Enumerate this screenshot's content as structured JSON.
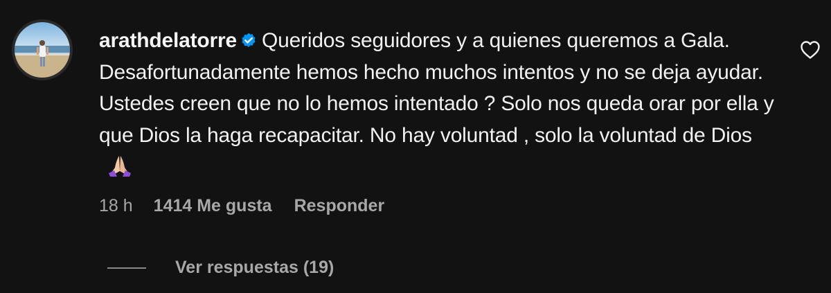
{
  "comment": {
    "username": "arathdelatorre",
    "verified": true,
    "text": "Queridos seguidores y a quienes queremos a Gala. Desafortunadamente hemos hecho muchos intentos y no se deja ayudar. Ustedes creen que no lo hemos intentado ? Solo nos queda orar por ella y que Dios la haga recapacitar. No hay voluntad , solo la voluntad de Dios",
    "emoji_icon": "folded-hands-icon",
    "time": "18 h",
    "likes": "1414 Me gusta",
    "reply_label": "Responder",
    "view_replies_label": "Ver respuestas (19)",
    "like_icon": "heart-outline-icon"
  },
  "colors": {
    "background": "#121212",
    "text": "#f5f5f5",
    "secondary": "#a8a8a8",
    "verified": "#0095f6"
  }
}
